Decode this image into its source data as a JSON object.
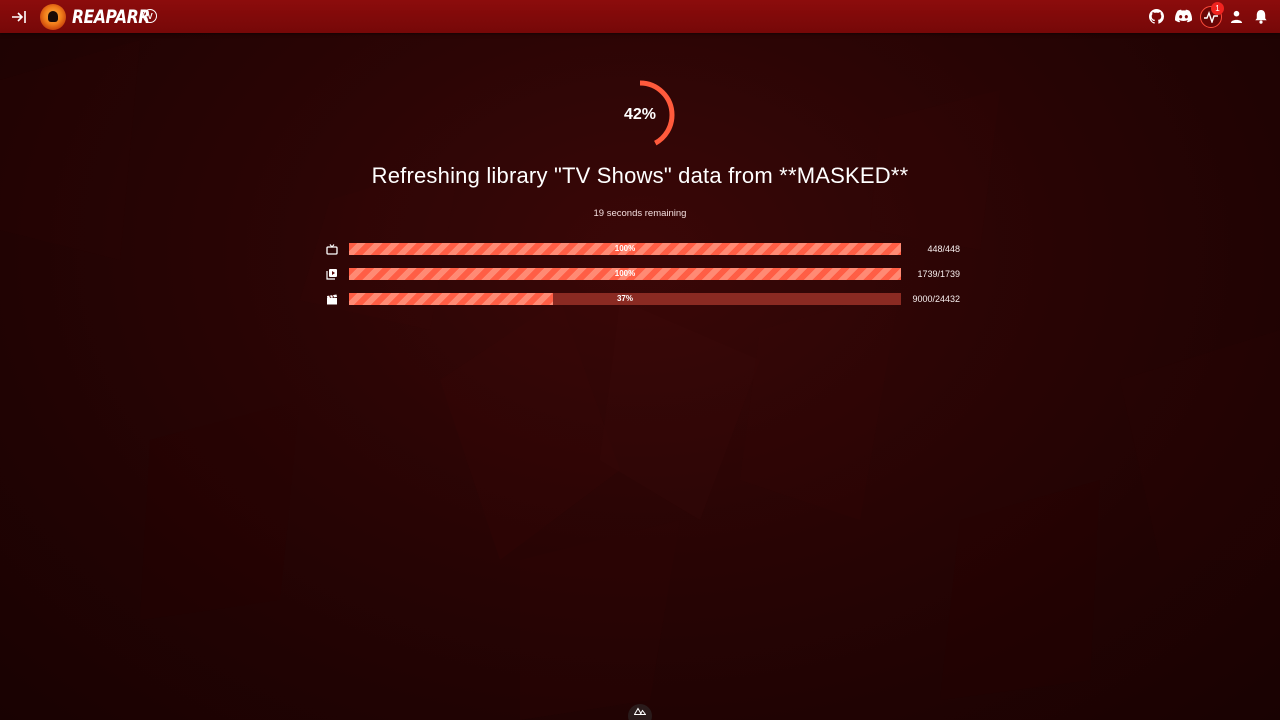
{
  "app": {
    "name": "REAPARR",
    "version_badge": "V",
    "notification_count": "1"
  },
  "topbar": {
    "left_icons": [
      "collapse-sidebar-icon"
    ],
    "right_icons": [
      "github-icon",
      "discord-icon",
      "activity-icon",
      "user-icon",
      "bell-icon"
    ]
  },
  "progress": {
    "overall_percent_label": "42%",
    "overall_percent_value": 42,
    "title": "Refreshing library \"TV Shows\" data from **MASKED**",
    "remaining": "19 seconds remaining",
    "rows": [
      {
        "icon": "tv-icon",
        "percent_label": "100%",
        "percent_value": 100,
        "count": "448/448"
      },
      {
        "icon": "playlist-play-icon",
        "percent_label": "100%",
        "percent_value": 100,
        "count": "1739/1739"
      },
      {
        "icon": "clapperboard-icon",
        "percent_label": "37%",
        "percent_value": 37,
        "count": "9000/24432"
      }
    ]
  },
  "colors": {
    "topbar": "#7f0a0a",
    "background": "#2a0404",
    "accent": "#ff5e45",
    "track": "#8a2a22"
  }
}
